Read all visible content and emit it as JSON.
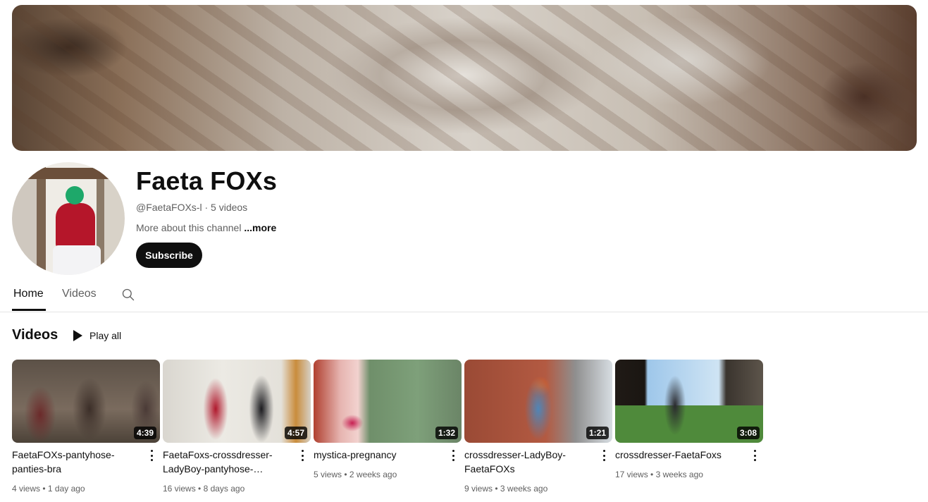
{
  "channel": {
    "name": "Faeta FOXs",
    "handle": "@FaetaFOXs-l",
    "video_count": "5 videos",
    "about_text": "More about this channel",
    "about_more": "...more",
    "subscribe_label": "Subscribe"
  },
  "tabs": [
    {
      "label": "Home",
      "selected": true
    },
    {
      "label": "Videos",
      "selected": false
    }
  ],
  "section": {
    "title": "Videos",
    "play_all_label": "Play all"
  },
  "videos": [
    {
      "title": "FaetaFOXs-pantyhose-panties-bra",
      "duration": "4:39",
      "views": "4 views",
      "age": "1 day ago"
    },
    {
      "title": "FaetaFoxs-crossdresser-LadyBoy-pantyhose-panties…",
      "duration": "4:57",
      "views": "16 views",
      "age": "8 days ago"
    },
    {
      "title": "mystica-pregnancy",
      "duration": "1:32",
      "views": "5 views",
      "age": "2 weeks ago"
    },
    {
      "title": "crossdresser-LadyBoy-FaetaFOXs",
      "duration": "1:21",
      "views": "9 views",
      "age": "3 weeks ago"
    },
    {
      "title": "crossdresser-FaetaFoxs",
      "duration": "3:08",
      "views": "17 views",
      "age": "3 weeks ago"
    }
  ],
  "icons": {
    "search": "search-icon",
    "play": "play-icon",
    "more": "more-vert-icon"
  }
}
